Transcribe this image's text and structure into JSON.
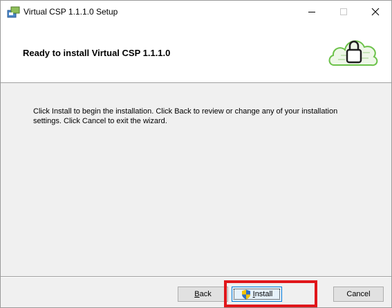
{
  "window": {
    "title": "Virtual CSP 1.1.1.0 Setup",
    "controls": {
      "minimize": "minimize-icon",
      "maximize": "maximize-icon",
      "close": "close-icon"
    }
  },
  "banner": {
    "title": "Ready to install Virtual CSP 1.1.1.0",
    "logo": "cloud-lock-icon"
  },
  "content": {
    "message": "Click Install to begin the installation. Click Back to review or change any of your installation settings. Click Cancel to exit the wizard."
  },
  "buttons": {
    "back": {
      "label": "Back",
      "accelerator": "B"
    },
    "install": {
      "label": "Install",
      "accelerator": "I",
      "icon": "uac-shield-icon"
    },
    "cancel": {
      "label": "Cancel"
    }
  },
  "colors": {
    "highlight": "#e0161b",
    "logo_green": "#6cc24a",
    "window_bg": "#f0f0f0"
  }
}
